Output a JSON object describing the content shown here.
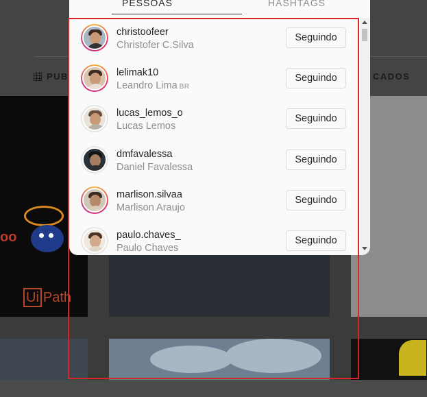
{
  "background": {
    "tabs": {
      "posts_partial": "PUBI",
      "tagged_partial": "CADOS"
    },
    "uipath_logo_text": "Path",
    "uipath_logo_box": "Ui"
  },
  "modal": {
    "tabs": [
      {
        "label": "PESSOAS",
        "active": true
      },
      {
        "label": "HASHTAGS",
        "active": false
      }
    ],
    "following": [
      {
        "username": "christoofeer",
        "full_name": "Christofer C.Silva",
        "badge": "",
        "button": "Seguindo",
        "story_ring": true
      },
      {
        "username": "lelimak10",
        "full_name": "Leandro Lima",
        "badge": "BR",
        "button": "Seguindo",
        "story_ring": true
      },
      {
        "username": "lucas_lemos_o",
        "full_name": "Lucas Lemos",
        "badge": "",
        "button": "Seguindo",
        "story_ring": false
      },
      {
        "username": "dmfavalessa",
        "full_name": "Daniel Favalessa",
        "badge": "",
        "button": "Seguindo",
        "story_ring": false
      },
      {
        "username": "marlison.silvaa",
        "full_name": "Marlison Araujo",
        "badge": "",
        "button": "Seguindo",
        "story_ring": true
      },
      {
        "username": "paulo.chaves_",
        "full_name": "Paulo Chaves",
        "badge": "",
        "button": "Seguindo",
        "story_ring": false
      }
    ]
  },
  "colors": {
    "highlight": "#d9242c",
    "story_ring": "#e1306c",
    "secondary_text": "#8e8e8e"
  }
}
